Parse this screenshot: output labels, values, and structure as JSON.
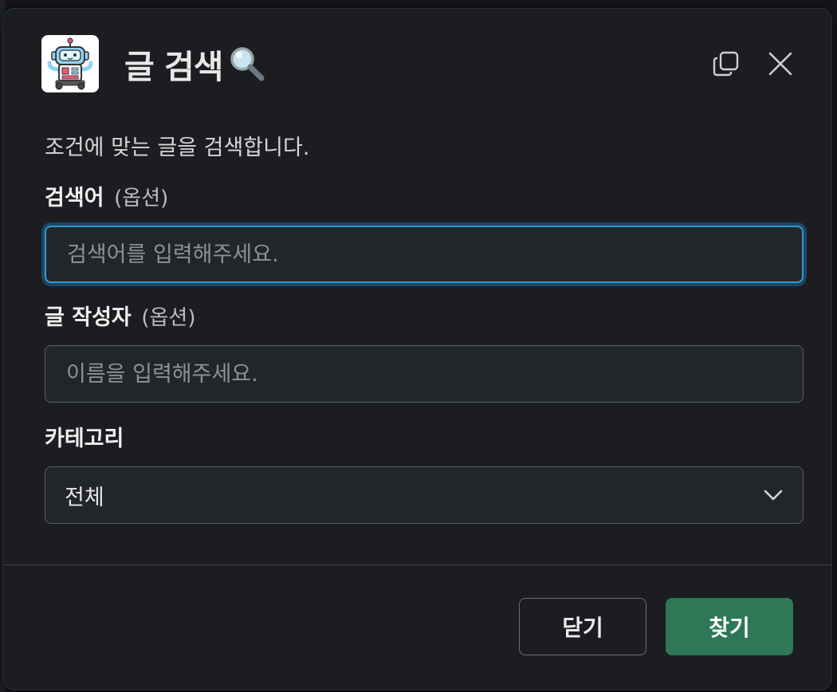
{
  "modal": {
    "title": "글 검색",
    "title_emoji_icon": "magnifier-icon",
    "app_icon": "robot-icon",
    "actions": {
      "copy_icon": "copy-icon",
      "close_icon": "close-icon"
    },
    "description": "조건에 맞는 글을 검색합니다."
  },
  "fields": {
    "keyword": {
      "label": "검색어",
      "optional": "(옵션)",
      "value": "",
      "placeholder": "검색어를 입력해주세요."
    },
    "author": {
      "label": "글 작성자",
      "optional": "(옵션)",
      "value": "",
      "placeholder": "이름을 입력해주세요."
    },
    "category": {
      "label": "카테고리",
      "selected": "전체"
    }
  },
  "footer": {
    "close_label": "닫기",
    "submit_label": "찾기"
  },
  "colors": {
    "modal_bg": "#1b1d21",
    "focus_ring": "#2f9ad8",
    "primary_button": "#2f7857"
  }
}
